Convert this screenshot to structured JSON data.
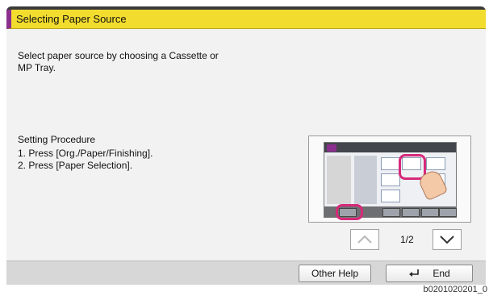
{
  "window": {
    "title": "Selecting Paper Source"
  },
  "main": {
    "intro_text": "Select paper source by choosing a Cassette or MP Tray.",
    "procedure_heading": "Setting Procedure",
    "steps": [
      "1. Press [Org./Paper/Finishing].",
      "2. Press [Paper Selection]."
    ],
    "preview_image": "touch-panel-illustration"
  },
  "pagination": {
    "indicator": "1/2",
    "prev_icon": "chevron-up-icon",
    "next_icon": "chevron-down-icon"
  },
  "footer": {
    "other_help_label": "Other Help",
    "end_label": "End",
    "end_icon": "enter-return-icon"
  },
  "image_code": "b0201020201_0",
  "colors": {
    "title_bar": "#f2dc2e",
    "title_accent": "#8b2f8e",
    "highlight": "#d6297a"
  }
}
